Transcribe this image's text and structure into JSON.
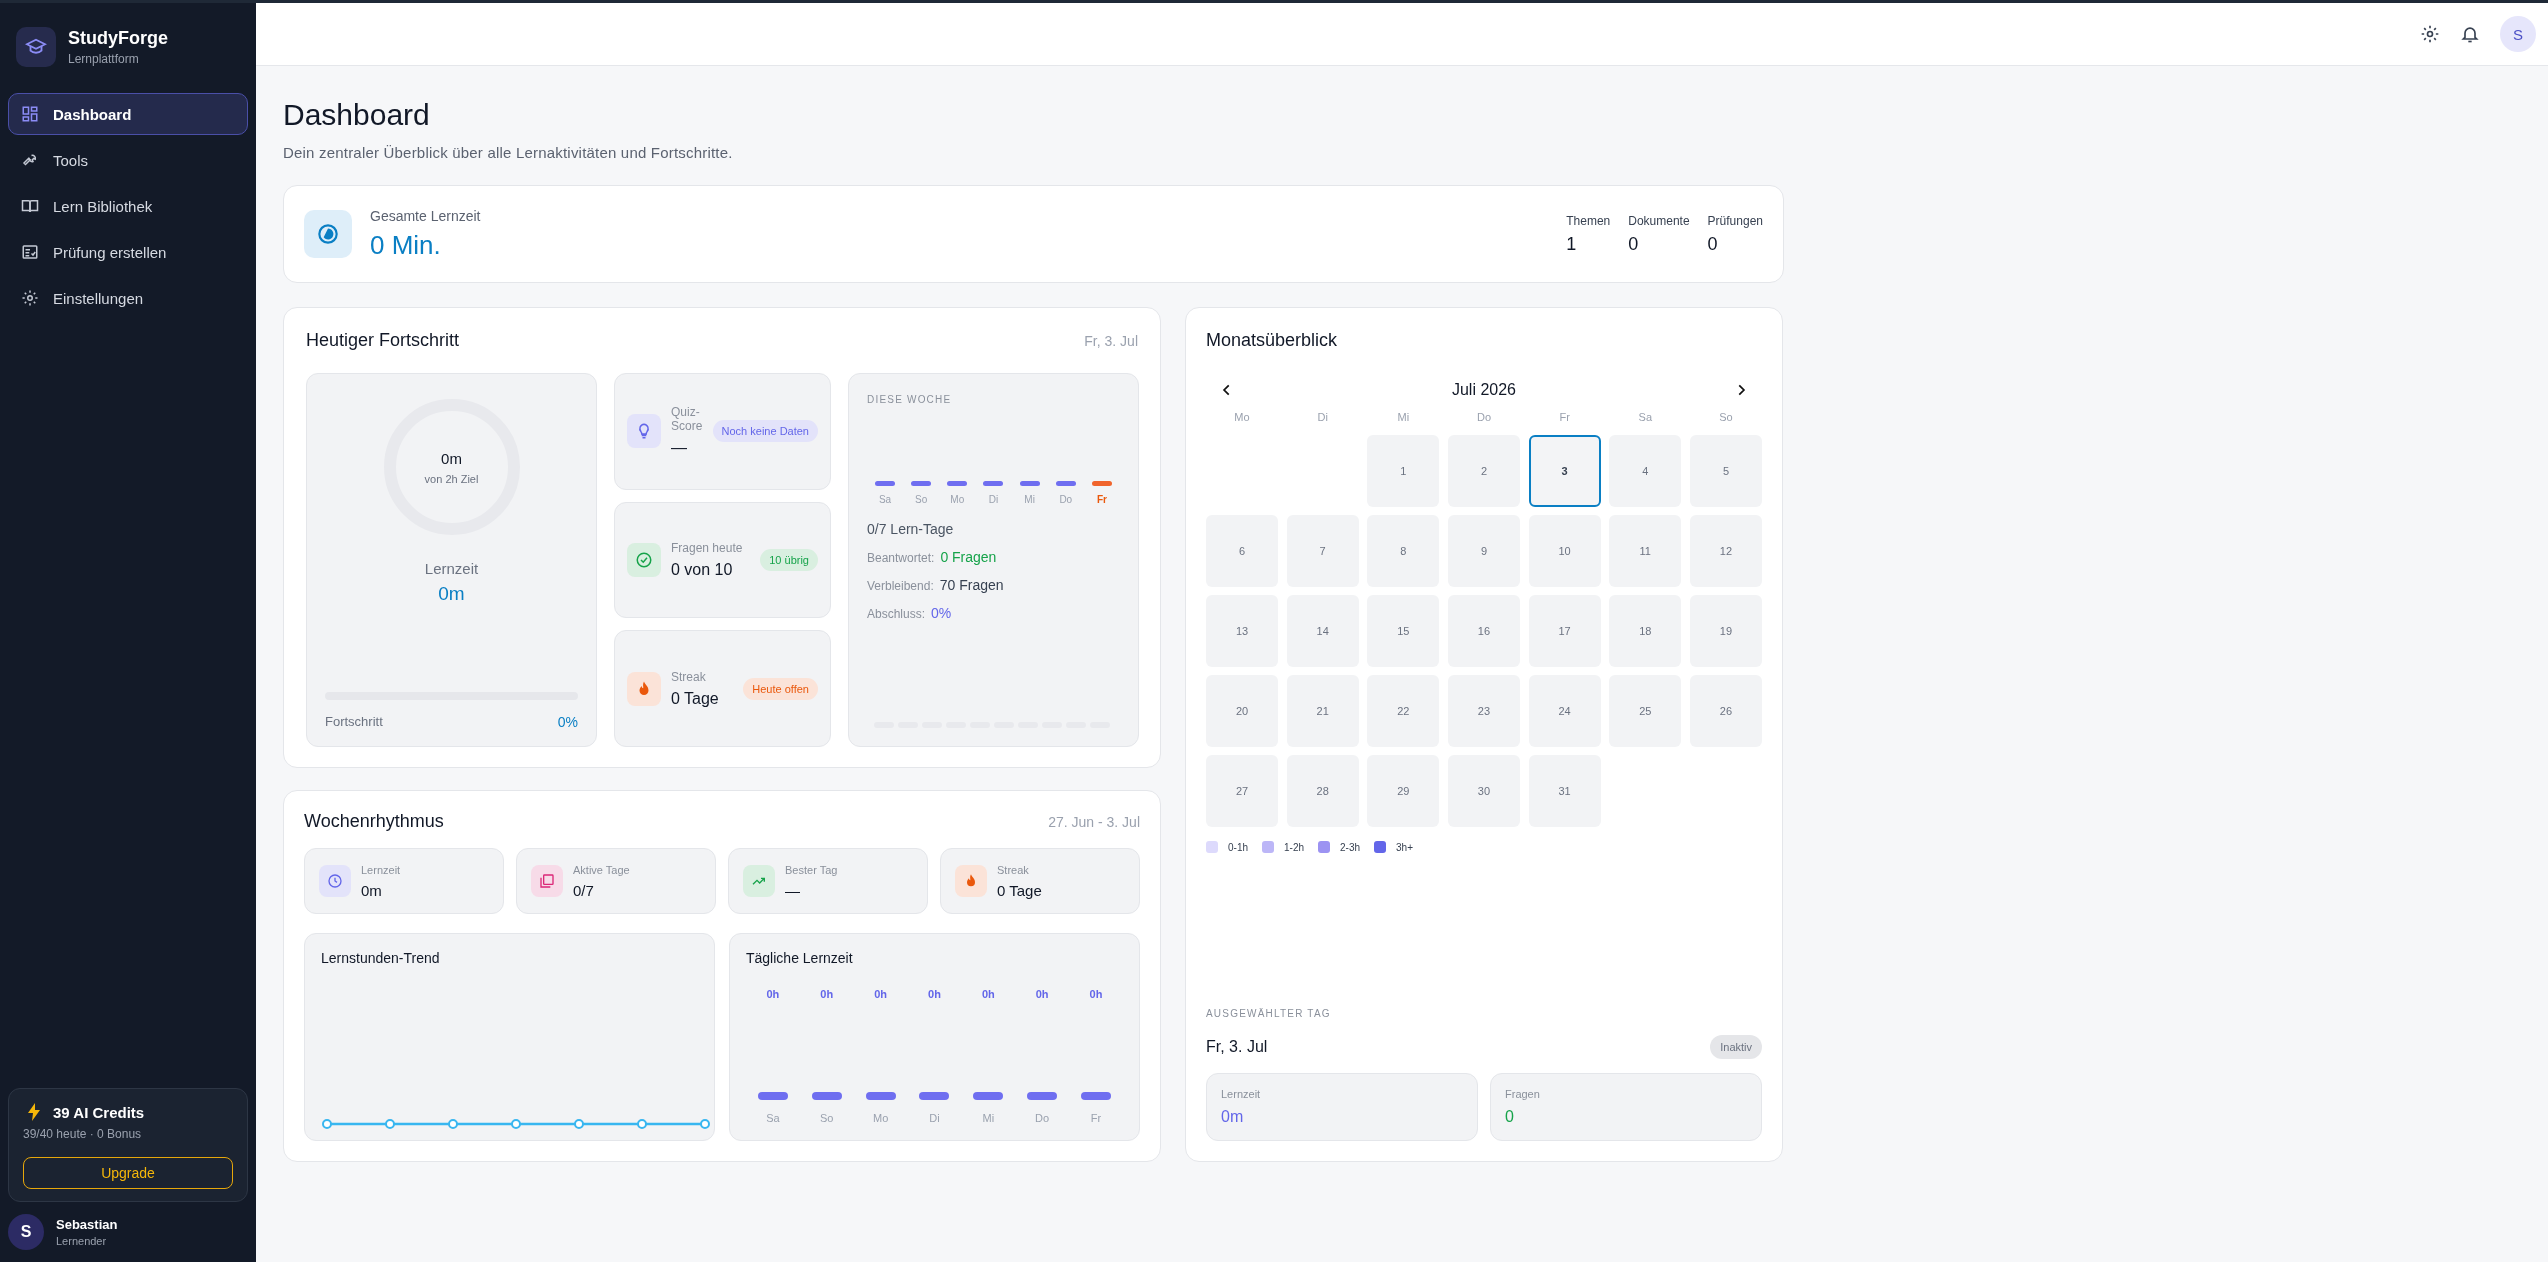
{
  "sidebar": {
    "brand": {
      "name": "StudyForge",
      "tagline": "Lernplattform"
    },
    "items": [
      {
        "label": "Dashboard",
        "selected": true
      },
      {
        "label": "Tools",
        "selected": false
      },
      {
        "label": "Lern Bibliothek",
        "selected": false
      },
      {
        "label": "Prüfung erstellen",
        "selected": false
      },
      {
        "label": "Einstellungen",
        "selected": false
      }
    ],
    "credits": {
      "title": "39 AI Credits",
      "detail": "39/40 heute · 0 Bonus",
      "button": "Upgrade"
    },
    "user": {
      "initial": "S",
      "name": "Sebastian",
      "role": "Lernender"
    }
  },
  "topbar": {
    "avatar_initial": "S"
  },
  "page": {
    "title": "Dashboard",
    "subtitle": "Dein zentraler Überblick über alle Lernaktivitäten und Fortschritte."
  },
  "summary": {
    "label": "Gesamte Lernzeit",
    "value": "0 Min.",
    "stats": [
      {
        "label": "Themen",
        "value": "1"
      },
      {
        "label": "Dokumente",
        "value": "0"
      },
      {
        "label": "Prüfungen",
        "value": "0"
      }
    ]
  },
  "today": {
    "title": "Heutiger Fortschritt",
    "date": "Fr, 3. Jul",
    "ring": {
      "value": "0m",
      "goal": "von 2h Ziel"
    },
    "label": "Lernzeit",
    "time": "0m",
    "progress": {
      "label": "Fortschritt",
      "level": 0,
      "reading": "0%"
    },
    "tiles": [
      {
        "kind": "quiz",
        "label": "Quiz-Score",
        "value": "—",
        "badge": "Noch keine Daten"
      },
      {
        "kind": "questions",
        "label": "Fragen heute",
        "value": "0 von 10",
        "badge": "10 übrig"
      },
      {
        "kind": "streak",
        "label": "Streak",
        "value": "0 Tage",
        "badge": "Heute offen"
      }
    ],
    "week": {
      "heading": "DIESE WOCHE",
      "days": [
        {
          "label": "Sa",
          "today": false
        },
        {
          "label": "So",
          "today": false
        },
        {
          "label": "Mo",
          "today": false
        },
        {
          "label": "Di",
          "today": false
        },
        {
          "label": "Mi",
          "today": false
        },
        {
          "label": "Do",
          "today": false
        },
        {
          "label": "Fr",
          "today": true
        }
      ],
      "summary": "0/7 Lern-Tage",
      "rows": [
        {
          "kind": "answered",
          "label": "Beantwortet:",
          "value": "0 Fragen"
        },
        {
          "kind": "remaining",
          "label": "Verbleibend:",
          "value": "70 Fragen"
        },
        {
          "kind": "completion",
          "label": "Abschluss:",
          "value": "0%"
        }
      ]
    }
  },
  "rhythm": {
    "title": "Wochenrhythmus",
    "range": "27. Jun - 3. Jul",
    "stats": [
      {
        "kind": "time",
        "label": "Lernzeit",
        "value": "0m"
      },
      {
        "kind": "days",
        "label": "Aktive Tage",
        "value": "0/7"
      },
      {
        "kind": "best",
        "label": "Bester Tag",
        "value": "—"
      },
      {
        "kind": "streak",
        "label": "Streak",
        "value": "0 Tage"
      }
    ],
    "trend": {
      "title": "Lernstunden-Trend"
    },
    "daily": {
      "title": "Tägliche Lernzeit",
      "days": [
        {
          "label": "Sa",
          "value": "0h"
        },
        {
          "label": "So",
          "value": "0h"
        },
        {
          "label": "Mo",
          "value": "0h"
        },
        {
          "label": "Di",
          "value": "0h"
        },
        {
          "label": "Mi",
          "value": "0h"
        },
        {
          "label": "Do",
          "value": "0h"
        },
        {
          "label": "Fr",
          "value": "0h"
        }
      ]
    }
  },
  "calendar": {
    "title": "Monatsüberblick",
    "month": "Juli 2026",
    "weekdays": [
      "Mo",
      "Di",
      "Mi",
      "Do",
      "Fr",
      "Sa",
      "So"
    ],
    "weeks": [
      [
        {
          "kind": "empty"
        },
        {
          "kind": "empty"
        },
        {
          "label": "1",
          "selected": false
        },
        {
          "label": "2",
          "selected": false
        },
        {
          "label": "3",
          "selected": true
        },
        {
          "label": "4",
          "selected": false
        },
        {
          "label": "5",
          "selected": false
        }
      ],
      [
        {
          "label": "6",
          "selected": false
        },
        {
          "label": "7",
          "selected": false
        },
        {
          "label": "8",
          "selected": false
        },
        {
          "label": "9",
          "selected": false
        },
        {
          "label": "10",
          "selected": false
        },
        {
          "label": "11",
          "selected": false
        },
        {
          "label": "12",
          "selected": false
        }
      ],
      [
        {
          "label": "13",
          "selected": false
        },
        {
          "label": "14",
          "selected": false
        },
        {
          "label": "15",
          "selected": false
        },
        {
          "label": "16",
          "selected": false
        },
        {
          "label": "17",
          "selected": false
        },
        {
          "label": "18",
          "selected": false
        },
        {
          "label": "19",
          "selected": false
        }
      ],
      [
        {
          "label": "20",
          "selected": false
        },
        {
          "label": "21",
          "selected": false
        },
        {
          "label": "22",
          "selected": false
        },
        {
          "label": "23",
          "selected": false
        },
        {
          "label": "24",
          "selected": false
        },
        {
          "label": "25",
          "selected": false
        },
        {
          "label": "26",
          "selected": false
        }
      ],
      [
        {
          "label": "27",
          "selected": false
        },
        {
          "label": "28",
          "selected": false
        },
        {
          "label": "29",
          "selected": false
        },
        {
          "label": "30",
          "selected": false
        },
        {
          "label": "31",
          "selected": false
        },
        {
          "kind": "empty"
        },
        {
          "kind": "empty"
        }
      ]
    ],
    "legend": [
      {
        "label": "0-1h",
        "color": "#dddafc"
      },
      {
        "label": "1-2h",
        "color": "#bcb6f7"
      },
      {
        "label": "2-3h",
        "color": "#9c93f2"
      },
      {
        "label": "3h+",
        "color": "#6366e9"
      }
    ],
    "selected_day": {
      "heading": "AUSGEWÄHLTER TAG",
      "date": "Fr, 3. Jul",
      "status": "Inaktiv",
      "stats": [
        {
          "kind": "time",
          "label": "Lernzeit",
          "value": "0m"
        },
        {
          "kind": "questions",
          "label": "Fragen",
          "value": "0"
        }
      ]
    }
  }
}
